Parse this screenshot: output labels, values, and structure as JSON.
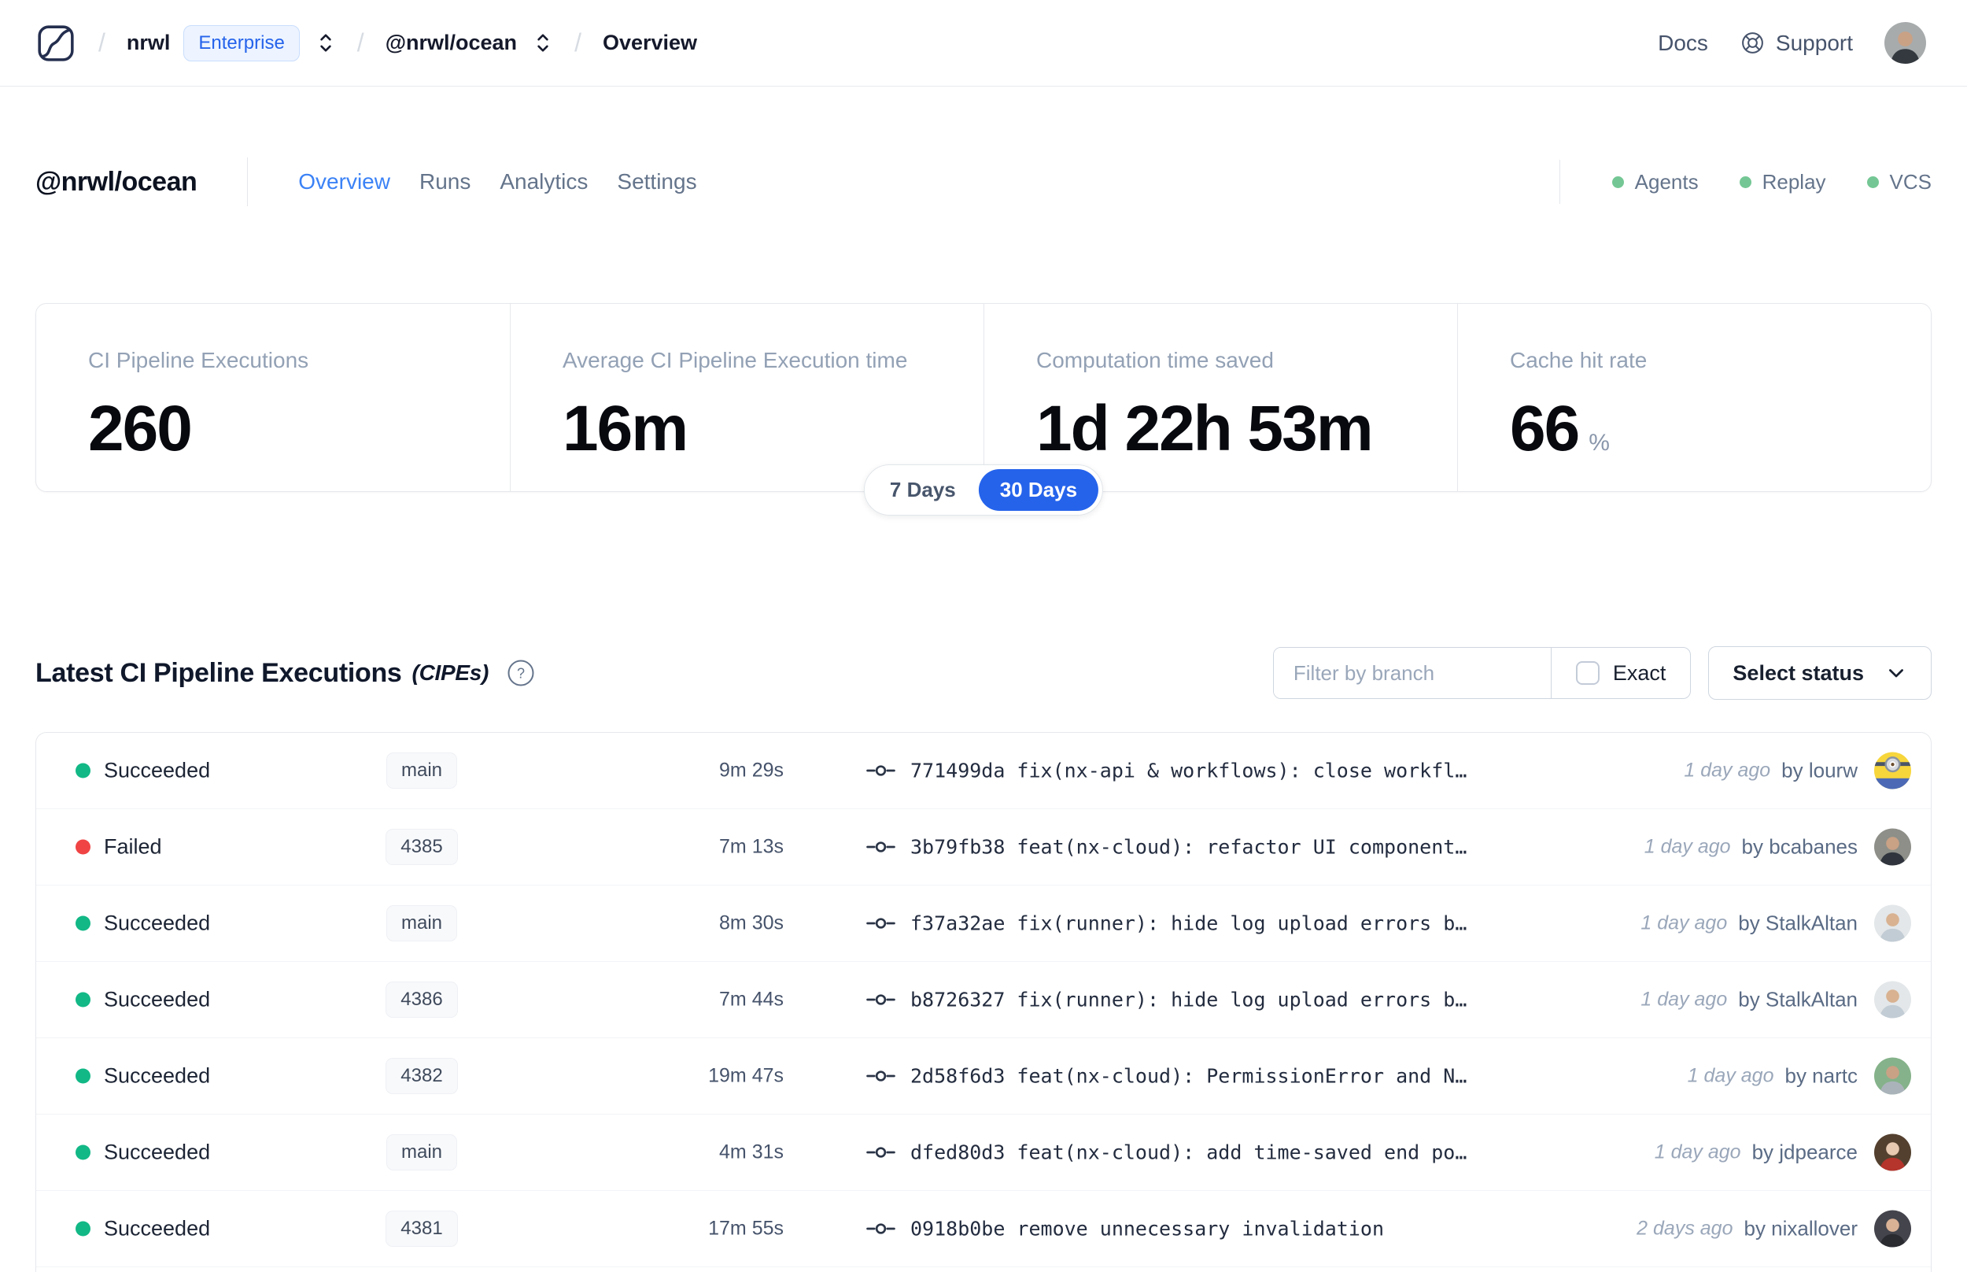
{
  "navbar": {
    "breadcrumb": {
      "org": "nrwl",
      "org_badge": "Enterprise",
      "workspace": "@nrwl/ocean",
      "page": "Overview"
    },
    "docs_label": "Docs",
    "support_label": "Support",
    "avatar": {
      "type": "person",
      "bg": "#a7abac",
      "skin": "#c9a185",
      "body": "#33393f"
    }
  },
  "header": {
    "title": "@nrwl/ocean",
    "tabs": [
      {
        "label": "Overview",
        "active": true
      },
      {
        "label": "Runs",
        "active": false
      },
      {
        "label": "Analytics",
        "active": false
      },
      {
        "label": "Settings",
        "active": false
      }
    ],
    "indicators": [
      {
        "label": "Agents",
        "color": "#74c794"
      },
      {
        "label": "Replay",
        "color": "#74c794"
      },
      {
        "label": "VCS",
        "color": "#74c794"
      }
    ]
  },
  "stats": {
    "cards": [
      {
        "label": "CI Pipeline Executions",
        "value": "260",
        "suffix": ""
      },
      {
        "label": "Average CI Pipeline Execution time",
        "value": "16m",
        "suffix": ""
      },
      {
        "label": "Computation time saved",
        "value": "1d 22h 53m",
        "suffix": ""
      },
      {
        "label": "Cache hit rate",
        "value": "66",
        "suffix": "%"
      }
    ],
    "range_toggle": {
      "options": [
        {
          "label": "7 Days",
          "active": false
        },
        {
          "label": "30 Days",
          "active": true
        }
      ]
    }
  },
  "cipe_section": {
    "title": "Latest CI Pipeline Executions",
    "title_suffix": "(CIPEs)",
    "filter_placeholder": "Filter by branch",
    "exact_label": "Exact",
    "status_select_label": "Select status",
    "rows": [
      {
        "status": "Succeeded",
        "status_color": "#12b886",
        "branch": "main",
        "duration": "9m 29s",
        "commit_hash": "771499da",
        "commit_message": "fix(nx-api & workflows): close workfl…",
        "time_ago": "1 day ago",
        "author": "by lourw",
        "avatar": {
          "type": "minion",
          "bg": "#f7d63c"
        }
      },
      {
        "status": "Failed",
        "status_color": "#f04444",
        "branch": "4385",
        "duration": "7m 13s",
        "commit_hash": "3b79fb38",
        "commit_message": "feat(nx-cloud): refactor UI component…",
        "time_ago": "1 day ago",
        "author": "by bcabanes",
        "avatar": {
          "type": "person",
          "bg": "#8d8f88",
          "skin": "#c9a185",
          "body": "#30353d"
        }
      },
      {
        "status": "Succeeded",
        "status_color": "#12b886",
        "branch": "main",
        "duration": "8m 30s",
        "commit_hash": "f37a32ae",
        "commit_message": "fix(runner): hide log upload errors b…",
        "time_ago": "1 day ago",
        "author": "by StalkAltan",
        "avatar": {
          "type": "person",
          "bg": "#e3e7e9",
          "skin": "#d8b291",
          "body": "#c2ccd4"
        }
      },
      {
        "status": "Succeeded",
        "status_color": "#12b886",
        "branch": "4386",
        "duration": "7m 44s",
        "commit_hash": "b8726327",
        "commit_message": "fix(runner): hide log upload errors b…",
        "time_ago": "1 day ago",
        "author": "by StalkAltan",
        "avatar": {
          "type": "person",
          "bg": "#e3e7e9",
          "skin": "#d8b291",
          "body": "#c2ccd4"
        }
      },
      {
        "status": "Succeeded",
        "status_color": "#12b886",
        "branch": "4382",
        "duration": "19m 47s",
        "commit_hash": "2d58f6d3",
        "commit_message": "feat(nx-cloud): PermissionError and N…",
        "time_ago": "1 day ago",
        "author": "by nartc",
        "avatar": {
          "type": "person",
          "bg": "#85b28a",
          "skin": "#c9a185",
          "body": "#aab3ba"
        }
      },
      {
        "status": "Succeeded",
        "status_color": "#12b886",
        "branch": "main",
        "duration": "4m 31s",
        "commit_hash": "dfed80d3",
        "commit_message": "feat(nx-cloud): add time-saved end po…",
        "time_ago": "1 day ago",
        "author": "by jdpearce",
        "avatar": {
          "type": "person",
          "bg": "#54402f",
          "skin": "#e7c9b1",
          "body": "#b5342c"
        }
      },
      {
        "status": "Succeeded",
        "status_color": "#12b886",
        "branch": "4381",
        "duration": "17m 55s",
        "commit_hash": "0918b0be",
        "commit_message": "remove unnecessary invalidation",
        "time_ago": "2 days ago",
        "author": "by nixallover",
        "avatar": {
          "type": "person",
          "bg": "#43444c",
          "skin": "#d9b195",
          "body": "#2a2b31"
        }
      }
    ]
  }
}
